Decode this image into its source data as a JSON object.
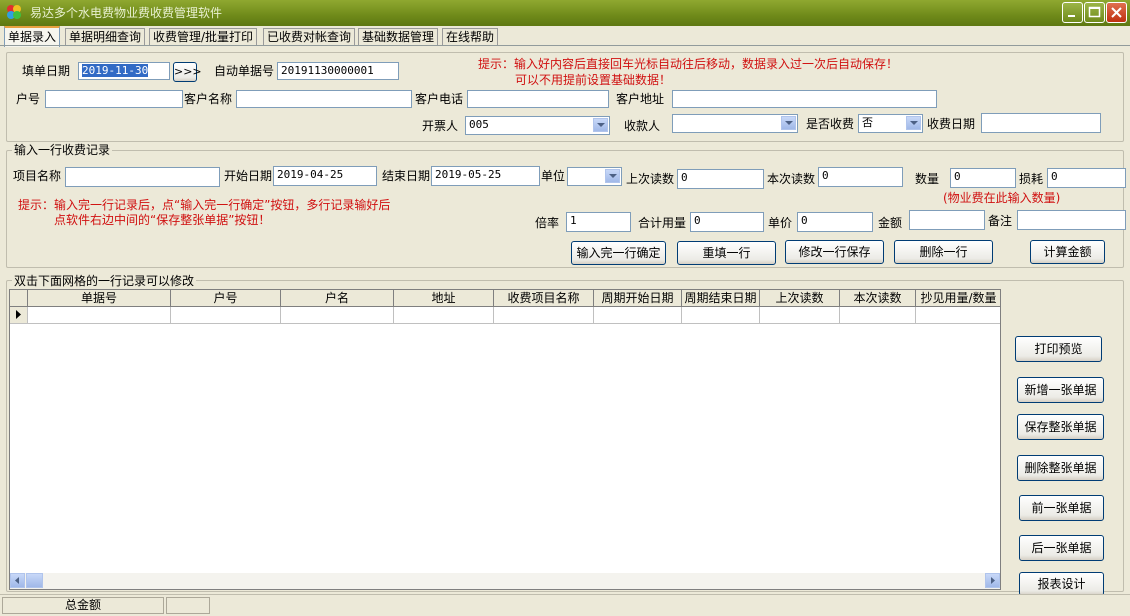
{
  "window": {
    "title": "易达多个水电费物业费收费管理软件"
  },
  "tabs": [
    "单据录入",
    "单据明细查询",
    "收费管理/批量打印",
    "已收费对帐查询",
    "基础数据管理",
    "在线帮助"
  ],
  "header": {
    "fill_date_label": "填单日期",
    "fill_date_value": "2019-11-30",
    "jump_label": ">>>",
    "auto_no_label": "自动单据号",
    "auto_no_value": "20191130000001",
    "tip_line1": "提示：输入好内容后直接回车光标自动往后移动，数据录入过一次后自动保存！",
    "tip_line2": "可以不用提前设置基础数据！",
    "account_label": "户号",
    "account_value": "",
    "customer_name_label": "客户名称",
    "customer_name_value": "",
    "customer_phone_label": "客户电话",
    "customer_phone_value": "",
    "customer_address_label": "客户地址",
    "customer_address_value": "",
    "issuer_label": "开票人",
    "issuer_value": "005",
    "payee_label": "收款人",
    "payee_value": "",
    "is_paid_label": "是否收费",
    "is_paid_value": "否",
    "pay_date_label": "收费日期",
    "pay_date_value": ""
  },
  "entry": {
    "group_label": "输入一行收费记录",
    "item_name_label": "项目名称",
    "item_name_value": "",
    "start_date_label": "开始日期",
    "start_date_value": "2019-04-25",
    "end_date_label": "结束日期",
    "end_date_value": "2019-05-25",
    "unit_label": "单位",
    "unit_value": "",
    "last_reading_label": "上次读数",
    "last_reading_value": "0",
    "this_reading_label": "本次读数",
    "this_reading_value": "0",
    "quantity_label": "数量",
    "quantity_value": "0",
    "loss_label": "损耗",
    "loss_value": "0",
    "quantity_note": "(物业费在此输入数量)",
    "tip_line1": "提示：输入完一行记录后，点“输入完一行确定”按钮，多行记录输好后",
    "tip_line2": "点软件右边中间的“保存整张单据”按钮！",
    "rate_label": "倍率",
    "rate_value": "1",
    "total_usage_label": "合计用量",
    "total_usage_value": "0",
    "unit_price_label": "单价",
    "unit_price_value": "0",
    "amount_label": "金额",
    "amount_value": "",
    "remark_label": "备注",
    "remark_value": "",
    "btn_confirm": "输入完一行确定",
    "btn_refill": "重填一行",
    "btn_modify_save": "修改一行保存",
    "btn_delete_row": "删除一行",
    "btn_calc": "计算金额"
  },
  "grid": {
    "group_label": "双击下面网格的一行记录可以修改",
    "columns": [
      "单据号",
      "户号",
      "户名",
      "地址",
      "收费项目名称",
      "周期开始日期",
      "周期结束日期",
      "上次读数",
      "本次读数",
      "抄见用量/数量"
    ]
  },
  "side_buttons": {
    "print_preview": "打印预览",
    "new_bill": "新增一张单据",
    "save_bill": "保存整张单据",
    "delete_bill": "删除整张单据",
    "prev_bill": "前一张单据",
    "next_bill": "后一张单据",
    "report_design": "报表设计"
  },
  "status": {
    "total_label": "总金额",
    "total_value": ""
  },
  "colors": {
    "titlebar": "#6f8a1a",
    "tip_red": "#d01010",
    "active_tab_accent": "#e8a040"
  }
}
